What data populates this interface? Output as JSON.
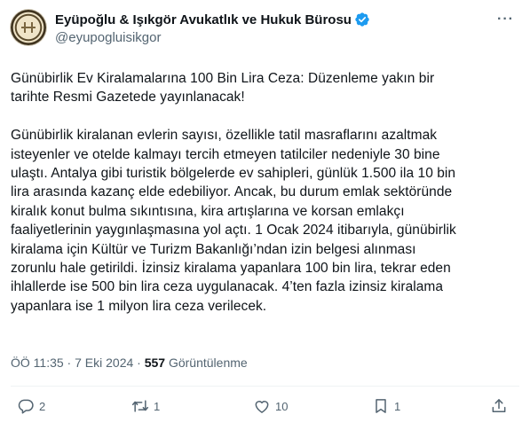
{
  "account": {
    "display_name": "Eyüpoğlu & Işıkgör Avukatlık ve Hukuk Bürosu",
    "handle": "@eyupogluisikgor",
    "verified": true
  },
  "tweet": {
    "text": "Günübirlik Ev Kiralamalarına 100 Bin Lira Ceza: Düzenleme yakın bir\ntarihte Resmi Gazetede yayınlanacak!\n\nGünübirlik kiralanan evlerin sayısı, özellikle tatil masraflarını azaltmak\nisteyenler ve otelde kalmayı tercih etmeyen tatilciler nedeniyle 30 bine\nulaştı. Antalya gibi turistik bölgelerde ev sahipleri, günlük 1.500 ila 10 bin\nlira arasında kazanç elde edebiliyor. Ancak, bu durum emlak sektöründe\nkiralık konut bulma sıkıntısına, kira artışlarına ve korsan emlakçı\nfaaliyetlerinin yaygınlaşmasına yol açtı. 1 Ocak 2024 itibarıyla, günübirlik\nkiralama için Kültür ve Turizm Bakanlığı’ndan izin belgesi alınması\nzorunlu hale getirildi. İzinsiz kiralama yapanlara 100 bin lira, tekrar eden\nihlallerde ise 500 bin lira ceza uygulanacak. 4’ten fazla izinsiz kiralama\nyapanlara ise 1 milyon lira ceza verilecek."
  },
  "meta": {
    "time_date": "ÖÖ 11:35 · 7 Eki 2024 · ",
    "views_count": "557",
    "views_label": " Görüntülenme"
  },
  "actions": {
    "replies": "2",
    "retweets": "1",
    "likes": "10",
    "bookmarks": "1"
  },
  "icons": {
    "verified": "verified-badge-icon",
    "more": "more-dots-icon",
    "reply": "reply-icon",
    "retweet": "retweet-icon",
    "like": "heart-icon",
    "bookmark": "bookmark-icon",
    "share": "share-icon"
  },
  "colors": {
    "verified_blue": "#1d9bf0",
    "text_primary": "#0f1419",
    "text_secondary": "#536471"
  }
}
